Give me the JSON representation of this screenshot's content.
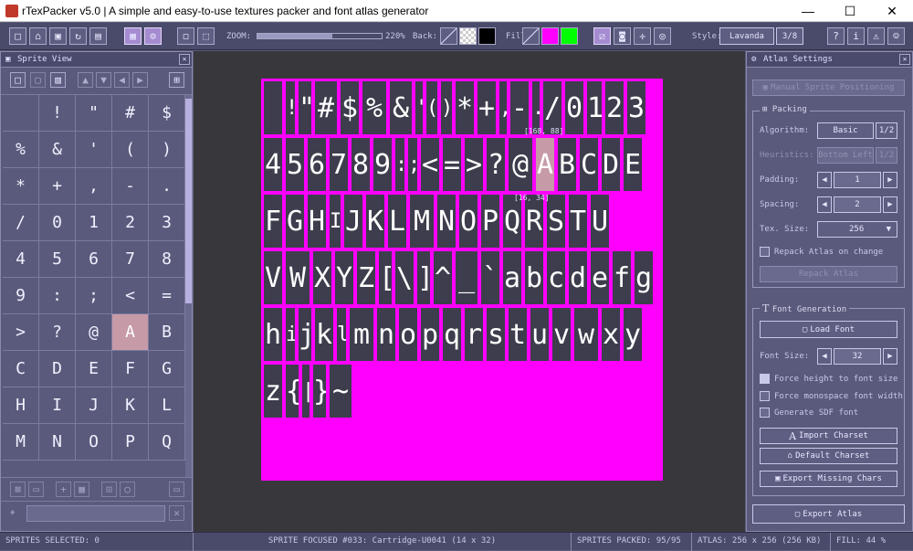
{
  "window": {
    "title": "rTexPacker v5.0 | A simple and easy-to-use textures packer and font atlas generator",
    "minimize": "—",
    "maximize": "☐",
    "close": "✕"
  },
  "toolbar": {
    "zoom_label": "ZOOM:",
    "zoom_value": "220%",
    "zoom_level": 0.6,
    "back_label": "Back:",
    "fill_label": "Fill:",
    "style_label": "Style:",
    "style_value": "Lavanda",
    "style_index": "3/8",
    "fill_color": "#ff00ff",
    "fill_color2": "#00ff00",
    "back_dark": "#000000"
  },
  "sprite_view": {
    "title": "Sprite View",
    "sprites": [
      "",
      "!",
      "\"",
      "#",
      "$",
      "%",
      "&",
      "'",
      "(",
      ")",
      "*",
      "+",
      ",",
      "-",
      ".",
      "/",
      "0",
      "1",
      "2",
      "3",
      "4",
      "5",
      "6",
      "7",
      "8",
      "9",
      ":",
      ";",
      "<",
      "=",
      ">",
      "?",
      "@",
      "A",
      "B",
      "C",
      "D",
      "E",
      "F",
      "G",
      "H",
      "I",
      "J",
      "K",
      "L",
      "M",
      "N",
      "O",
      "P",
      "Q"
    ],
    "selected": "A"
  },
  "atlas": {
    "selected_coords": "[168, 88]",
    "selected_size": "[16, 34]",
    "rows": [
      [
        " ",
        "!",
        "\"",
        "#",
        "$",
        "%",
        "&",
        "'",
        "(",
        ")",
        "*",
        "+",
        ",",
        "-",
        ".",
        "/",
        "0",
        "1",
        "2",
        "3"
      ],
      [
        "4",
        "5",
        "6",
        "7",
        "8",
        "9",
        ":",
        ";",
        "<",
        "=",
        ">",
        "?",
        "@",
        "A",
        "B",
        "C",
        "D",
        "E"
      ],
      [
        "F",
        "G",
        "H",
        "I",
        "J",
        "K",
        "L",
        "M",
        "N",
        "O",
        "P",
        "Q",
        "R",
        "S",
        "T",
        "U"
      ],
      [
        "V",
        "W",
        "X",
        "Y",
        "Z",
        "[",
        "\\",
        "]",
        "^",
        "_",
        "`",
        "a",
        "b",
        "c",
        "d",
        "e",
        "f",
        "g"
      ],
      [
        "h",
        "i",
        "j",
        "k",
        "l",
        "m",
        "n",
        "o",
        "p",
        "q",
        "r",
        "s",
        "t",
        "u",
        "v",
        "w",
        "x",
        "y"
      ],
      [
        "z",
        "{",
        "|",
        "}",
        "~"
      ]
    ]
  },
  "settings": {
    "title": "Atlas Settings",
    "manual_positioning": "Manual Sprite Positioning",
    "packing_title": "Packing",
    "algorithm_label": "Algorithm:",
    "algorithm_value": "Basic",
    "algorithm_index": "1/2",
    "heuristics_label": "Heuristics:",
    "heuristics_value": "Bottom Left",
    "heuristics_index": "1/2",
    "padding_label": "Padding:",
    "padding_value": "1",
    "spacing_label": "Spacing:",
    "spacing_value": "2",
    "texsize_label": "Tex. Size:",
    "texsize_value": "256",
    "repack_on_change": "Repack Atlas on change",
    "repack_button": "Repack Atlas",
    "fontgen_title": "Font Generation",
    "load_font": "Load Font",
    "fontsize_label": "Font Size:",
    "fontsize_value": "32",
    "force_height": "Force height to font size",
    "force_mono": "Force monospace font width",
    "gen_sdf": "Generate SDF font",
    "import_charset": "Import Charset",
    "default_charset": "Default Charset",
    "export_missing": "Export Missing Chars",
    "export_atlas": "Export Atlas"
  },
  "status": {
    "selected": "SPRITES SELECTED: 0",
    "focused": "SPRITE FOCUSED #033: Cartridge-U0041 (14 x 32)",
    "packed": "SPRITES PACKED: 95/95",
    "atlas": "ATLAS: 256 x 256 (256 KB)",
    "fill": "FILL: 44 %"
  }
}
